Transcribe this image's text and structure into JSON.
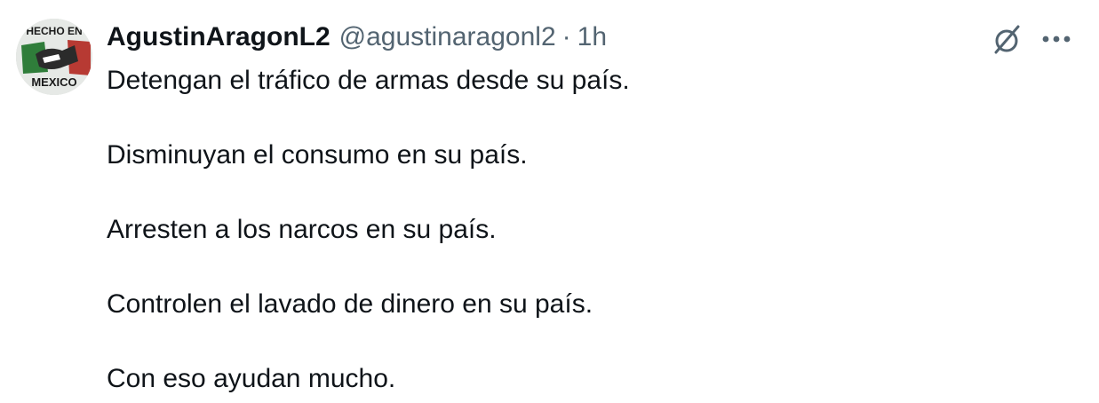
{
  "tweet": {
    "author": {
      "display_name": "AgustinAragonL2",
      "handle": "@agustinaragonl2",
      "avatar": {
        "icon": "avatar-hecho-en-mexico",
        "text_top": "HECHO EN",
        "text_bottom": "MEXICO",
        "colors": {
          "green": "#2f7d3a",
          "red": "#c0392b",
          "white": "#ffffff"
        }
      }
    },
    "separator": "·",
    "timestamp": "1h",
    "actions": {
      "grok_icon": "grok-slash-circle-icon",
      "more_icon": "more-horizontal-icon"
    },
    "paragraphs": [
      "Detengan el tráfico de armas desde su país.",
      "Disminuyan el consumo en su país.",
      "Arresten a los narcos en su país.",
      "Controlen el lavado de dinero en su país.",
      "Con eso ayudan mucho."
    ]
  }
}
